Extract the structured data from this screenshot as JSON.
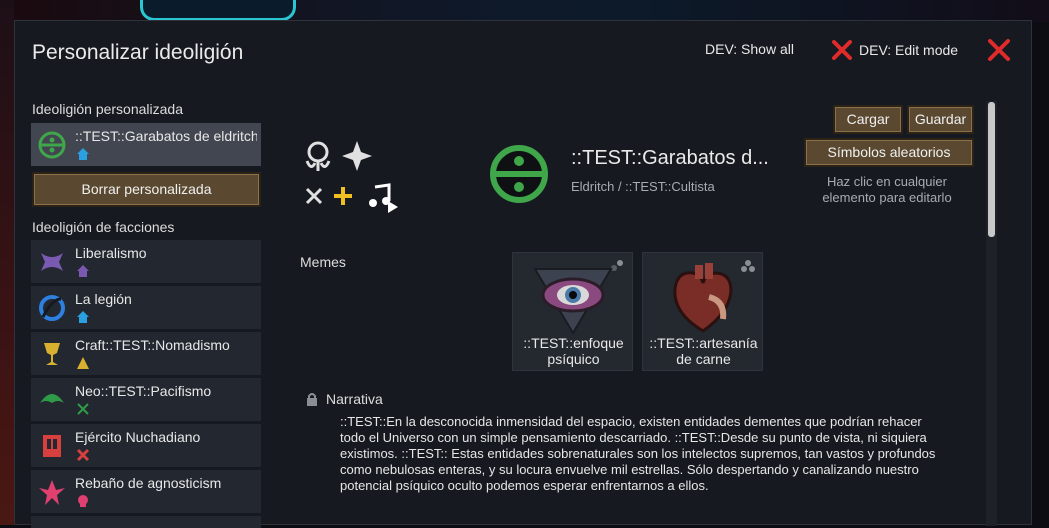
{
  "window": {
    "title": "Personalizar ideoligión",
    "dev_show_all": "DEV: Show all",
    "dev_edit_mode": "DEV: Edit mode"
  },
  "left": {
    "custom_header": "Ideoligión personalizada",
    "custom_item": {
      "label": "::TEST::Garabatos de eldritch",
      "icon": "eldritch-circle-icon",
      "color": "#3fa64a"
    },
    "delete_button": "Borrar personalizada",
    "factions_header": "Ideoligión de facciones",
    "factions": [
      {
        "label": "Liberalismo",
        "icon": "liberalism-icon",
        "color": "#7a5ab0",
        "sub_icon": "house-icon"
      },
      {
        "label": "La legión",
        "icon": "legion-icon",
        "color": "#2d7fe0",
        "sub_icon": "house-icon"
      },
      {
        "label": "Craft::TEST::Nomadismo",
        "icon": "chalice-icon",
        "color": "#d8b030",
        "sub_icon": "tent-icon"
      },
      {
        "label": "Neo::TEST::Pacifismo",
        "icon": "pacifism-icon",
        "color": "#2f9a48",
        "sub_icon": "crossed-tools-icon"
      },
      {
        "label": "Ejército Nuchadiano",
        "icon": "army-icon",
        "color": "#d84040",
        "sub_icon": "crossed-swords-icon"
      },
      {
        "label": "Rebaño de agnosticism",
        "icon": "flock-icon",
        "color": "#e04070",
        "sub_icon": "skull-icon"
      }
    ]
  },
  "ideo": {
    "name": "::TEST::Garabatos d...",
    "subtitle": "Eldritch / ::TEST::Cultista",
    "color": "#3fa64a",
    "load_button": "Cargar",
    "save_button": "Guardar",
    "random_symbols_button": "Símbolos aleatorios",
    "hint": "Haz clic en cualquier elemento para editarlo"
  },
  "memes": {
    "label": "Memes",
    "items": [
      {
        "label": "::TEST::enfoque psíquico",
        "icon": "psychic-eye-icon"
      },
      {
        "label": "::TEST::artesanía de carne",
        "icon": "flesh-heart-icon"
      }
    ]
  },
  "narrative": {
    "label": "Narrativa",
    "text": "::TEST::En la desconocida inmensidad del espacio, existen entidades dementes que podrían rehacer todo el Universo con un simple pensamiento descarriado. ::TEST::Desde su punto de vista, ni siquiera existimos. ::TEST:: Estas entidades sobrenaturales son los intelectos supremos, tan vastos y profundos como nebulosas enteras, y su locura envuelve mil estrellas. Sólo despertando y canalizando nuestro potencial psíquico oculto podemos esperar enfrentarnos a ellos."
  },
  "colors": {
    "accent_red": "#e02b2b",
    "button_brown": "#5a4930",
    "panel_bg": "#161a20"
  }
}
